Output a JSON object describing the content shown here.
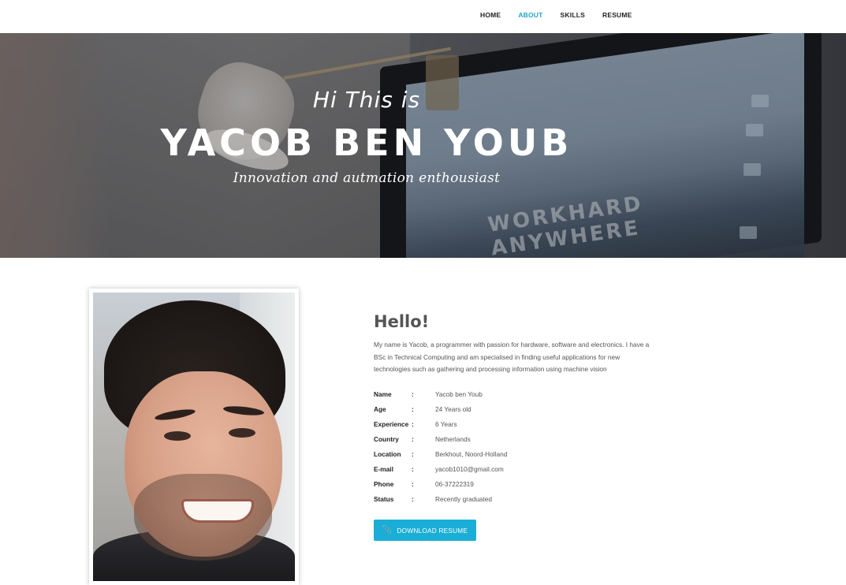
{
  "nav": {
    "items": [
      {
        "label": "HOME",
        "active": false
      },
      {
        "label": "ABOUT",
        "active": true
      },
      {
        "label": "SKILLS",
        "active": false
      },
      {
        "label": "RESUME",
        "active": false
      }
    ],
    "accent_color": "#1fa6c9"
  },
  "hero": {
    "greeting": "Hi This is",
    "name": "YACOB BEN YOUB",
    "tagline": "Innovation and autmation enthousiast",
    "screen_text": [
      "WORKHARD",
      "ANYWHERE"
    ]
  },
  "about": {
    "heading": "Hello!",
    "bio": "My name is Yacob, a programmer with passion for hardware, software and electronics. I have a BSc in Technical Computing and am specialised in finding useful applications for new technologies such as gathering and processing information using machine vision",
    "details": [
      {
        "label": "Name",
        "value": "Yacob ben Youb"
      },
      {
        "label": "Age",
        "value": "24 Years old"
      },
      {
        "label": "Experience",
        "value": "6 Years"
      },
      {
        "label": "Country",
        "value": "Netherlands"
      },
      {
        "label": "Location",
        "value": "Berkhout, Noord-Holland"
      },
      {
        "label": "E-mail",
        "value": "yacob1010@gmail.com"
      },
      {
        "label": "Phone",
        "value": "06-37222319"
      },
      {
        "label": "Status",
        "value": "Recently graduated"
      }
    ],
    "separator": ":",
    "download_label": "DOWNLOAD RESUME",
    "download_icon": "paperclip-icon",
    "button_color": "#1aaed6"
  }
}
